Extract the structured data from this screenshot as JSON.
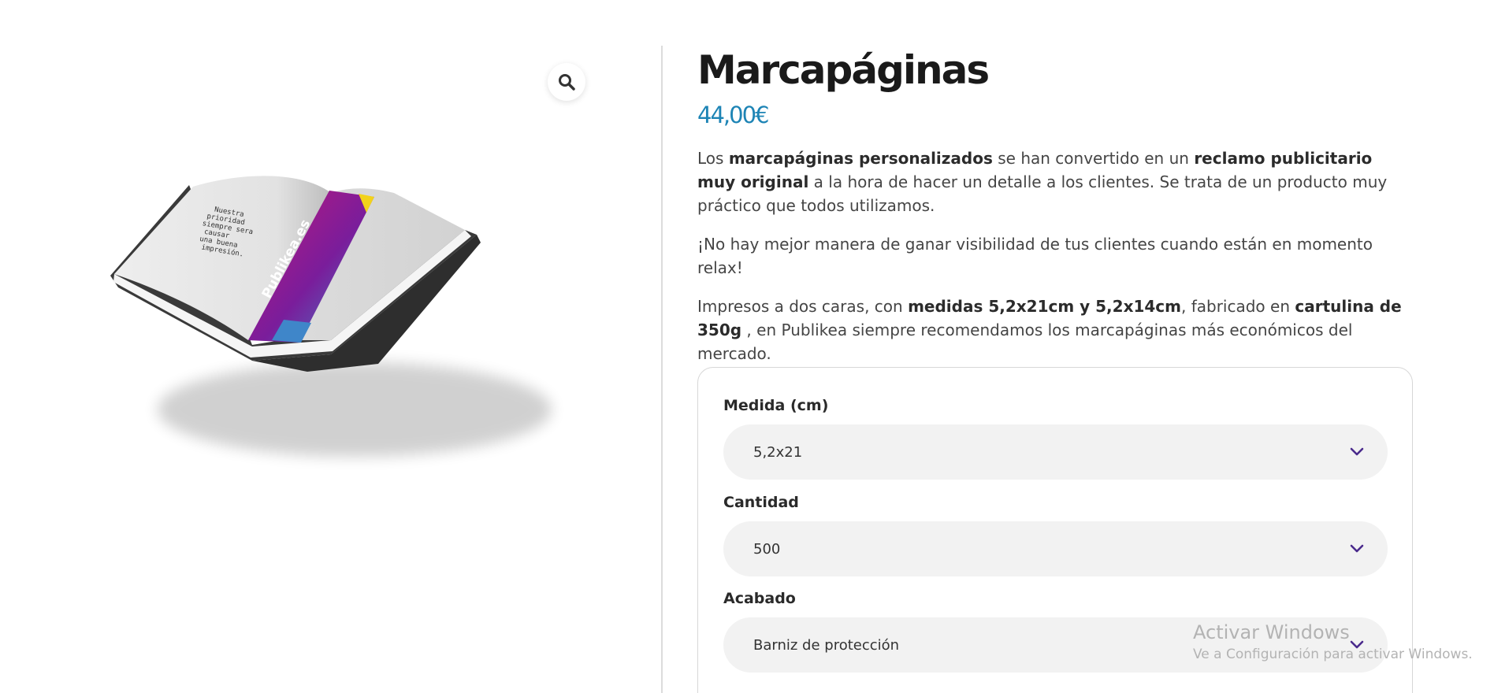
{
  "gallery": {
    "zoom_icon": "search-icon",
    "image_alt": "Marcapáginas",
    "book_quote": [
      "Nuestra",
      "prioridad",
      "siempre sera",
      "causar",
      "una buena",
      "impresión."
    ],
    "bookmark_text": "Publikea.es"
  },
  "product": {
    "title": "Marcapáginas",
    "price": "44,00€",
    "price_color": "#1d84b5"
  },
  "description": {
    "p1": {
      "t1": "Los ",
      "b1": "marcapáginas personalizados",
      "t2": " se han convertido en un ",
      "b2": "reclamo publicitario muy original",
      "t3": " a la hora de hacer un detalle a los clientes. Se trata de un producto muy práctico que todos utilizamos."
    },
    "p2": "¡No hay mejor manera de ganar visibilidad de tus clientes cuando están en momento relax!",
    "p3": {
      "t1": "Impresos a dos caras, con ",
      "b1": "medidas 5,2x21cm y 5,2x14cm",
      "t2": ",  fabricado en ",
      "b2": "cartulina de 350g",
      "t3": " , en Publikea siempre recomendamos los marcapáginas más económicos del mercado."
    }
  },
  "options": {
    "medida": {
      "label": "Medida (cm)",
      "value": "5,2x21"
    },
    "cantidad": {
      "label": "Cantidad",
      "value": "500"
    },
    "acabado": {
      "label": "Acabado",
      "value": "Barniz de protección"
    },
    "chevron_icon": "chevron-down-icon",
    "chevron_color": "#4a2a8c"
  },
  "watermark": {
    "line1": "Activar Windows",
    "line2": "Ve a Configuración para activar Windows."
  }
}
